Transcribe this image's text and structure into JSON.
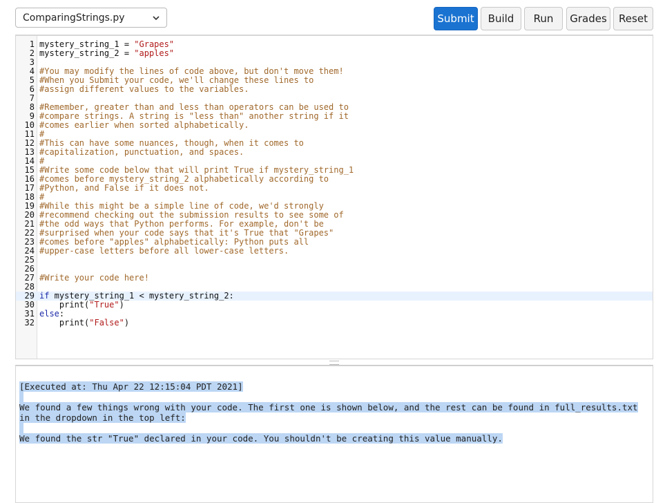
{
  "toolbar": {
    "file_select": "ComparingStrings.py",
    "submit_label": "Submit",
    "build_label": "Build",
    "run_label": "Run",
    "grades_label": "Grades",
    "reset_label": "Reset",
    "chevron_icon": "chevron-down-icon"
  },
  "colors": {
    "primary": "#1a73d1",
    "comment": "#a0682b",
    "string": "#b11a1a",
    "keyword": "#1c2aa8",
    "selection": "#bcd6f4"
  },
  "editor": {
    "active_line": 29,
    "lines": [
      [
        {
          "t": "mystery_string_1 = ",
          "c": ""
        },
        {
          "t": "\"Grapes\"",
          "c": "string"
        }
      ],
      [
        {
          "t": "mystery_string_2 = ",
          "c": ""
        },
        {
          "t": "\"apples\"",
          "c": "string"
        }
      ],
      [],
      [
        {
          "t": "#You may modify the lines of code above, but don't move them!",
          "c": "comment"
        }
      ],
      [
        {
          "t": "#When you Submit your code, we'll change these lines to",
          "c": "comment"
        }
      ],
      [
        {
          "t": "#assign different values to the variables.",
          "c": "comment"
        }
      ],
      [],
      [
        {
          "t": "#Remember, greater than and less than operators can be used to",
          "c": "comment"
        }
      ],
      [
        {
          "t": "#compare strings. A string is \"less than\" another string if it",
          "c": "comment"
        }
      ],
      [
        {
          "t": "#comes earlier when sorted alphabetically.",
          "c": "comment"
        }
      ],
      [
        {
          "t": "#",
          "c": "comment"
        }
      ],
      [
        {
          "t": "#This can have some nuances, though, when it comes to",
          "c": "comment"
        }
      ],
      [
        {
          "t": "#capitalization, punctuation, and spaces.",
          "c": "comment"
        }
      ],
      [
        {
          "t": "#",
          "c": "comment"
        }
      ],
      [
        {
          "t": "#Write some code below that will print True if mystery_string_1",
          "c": "comment"
        }
      ],
      [
        {
          "t": "#comes before mystery_string_2 alphabetically according to",
          "c": "comment"
        }
      ],
      [
        {
          "t": "#Python, and False if it does not.",
          "c": "comment"
        }
      ],
      [
        {
          "t": "#",
          "c": "comment"
        }
      ],
      [
        {
          "t": "#While this might be a simple line of code, we'd strongly",
          "c": "comment"
        }
      ],
      [
        {
          "t": "#recommend checking out the submission results to see some of",
          "c": "comment"
        }
      ],
      [
        {
          "t": "#the odd ways that Python performs. For example, don't be",
          "c": "comment"
        }
      ],
      [
        {
          "t": "#surprised when your code says that it's True that \"Grapes\"",
          "c": "comment"
        }
      ],
      [
        {
          "t": "#comes before \"apples\" alphabetically: Python puts all",
          "c": "comment"
        }
      ],
      [
        {
          "t": "#upper-case letters before all lower-case letters.",
          "c": "comment"
        }
      ],
      [],
      [],
      [
        {
          "t": "#Write your code here!",
          "c": "comment"
        }
      ],
      [],
      [
        {
          "t": "if",
          "c": "keyword"
        },
        {
          "t": " mystery_string_1 < mystery_string_2:",
          "c": ""
        }
      ],
      [
        {
          "t": "    print(",
          "c": ""
        },
        {
          "t": "\"True\"",
          "c": "string"
        },
        {
          "t": ")",
          "c": ""
        }
      ],
      [
        {
          "t": "else",
          "c": "keyword"
        },
        {
          "t": ":",
          "c": ""
        }
      ],
      [
        {
          "t": "    print(",
          "c": ""
        },
        {
          "t": "\"False\"",
          "c": "string"
        },
        {
          "t": ")",
          "c": ""
        }
      ]
    ]
  },
  "output": {
    "executed": "[Executed at: Thu Apr 22 12:15:04 PDT 2021]",
    "message1": "We found a few things wrong with your code. The first one is shown below, and the rest can be found in full_results.txt in the dropdown in the top left:",
    "message2": "We found the str \"True\" declared in your code. You shouldn't be creating this value manually."
  }
}
